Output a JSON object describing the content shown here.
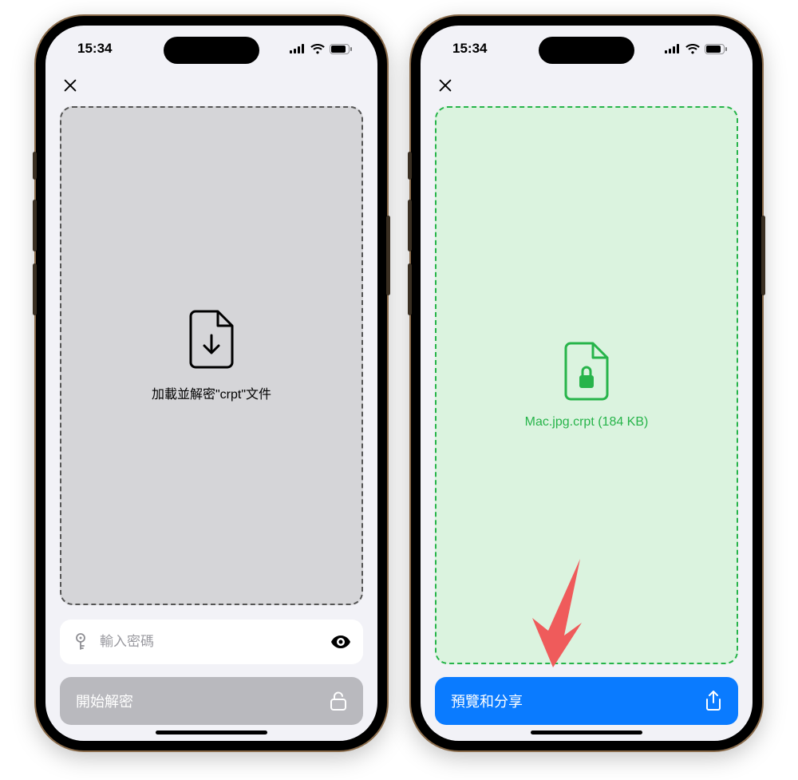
{
  "status": {
    "time": "15:34"
  },
  "left": {
    "drop_label": "加載並解密\"crpt\"文件",
    "password_placeholder": "輸入密碼",
    "action_label": "開始解密"
  },
  "right": {
    "file_label": "Mac.jpg.crpt (184 KB)",
    "action_label": "預覽和分享"
  }
}
